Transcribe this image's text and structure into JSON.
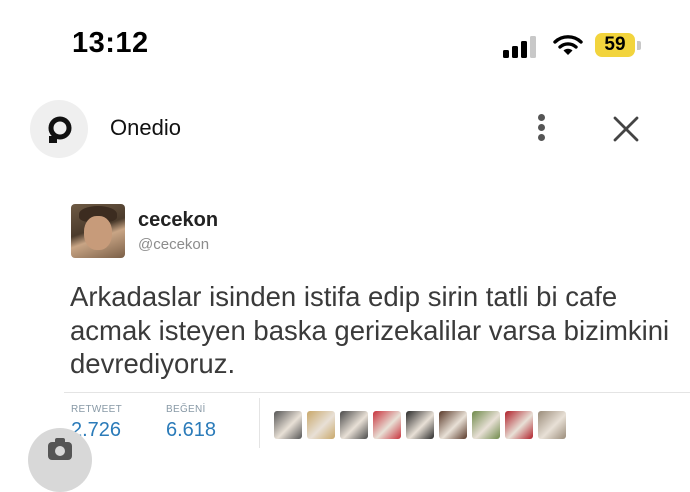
{
  "status_bar": {
    "time": "13:12",
    "battery": "59",
    "icons": [
      "cellular-signal-icon",
      "wifi-icon",
      "battery-icon"
    ],
    "battery_color": "#f2d43d"
  },
  "app_bar": {
    "logo_icon": "onedio-logo-icon",
    "title": "Onedio",
    "menu_icon": "more-vertical-icon",
    "close_icon": "close-icon"
  },
  "tweet": {
    "display_name": "cecekon",
    "handle": "@cecekon",
    "text": "Arkadaslar isinden istifa edip sirin tatli bi cafe acmak isteyen baska gerizekalilar varsa bizimkini devrediyoruz.",
    "retweet_label": "RETWEET",
    "retweet_count": "2.726",
    "like_label": "BEĞENİ",
    "like_count": "6.618",
    "stat_color": "#2b7bb9",
    "liker_avatars": [
      {
        "name": "liker-avatar-1",
        "color": "#555555"
      },
      {
        "name": "liker-avatar-2",
        "color": "#c9a86a"
      },
      {
        "name": "liker-avatar-3",
        "color": "#4a4a4a"
      },
      {
        "name": "liker-avatar-4",
        "color": "#c8323c"
      },
      {
        "name": "liker-avatar-5",
        "color": "#2a2a2a"
      },
      {
        "name": "liker-avatar-6",
        "color": "#5a3a2a"
      },
      {
        "name": "liker-avatar-7",
        "color": "#6f8a4a"
      },
      {
        "name": "liker-avatar-8",
        "color": "#b0202a"
      },
      {
        "name": "liker-avatar-9",
        "color": "#9a8c7a"
      }
    ]
  },
  "fab_icon": "camera-icon"
}
